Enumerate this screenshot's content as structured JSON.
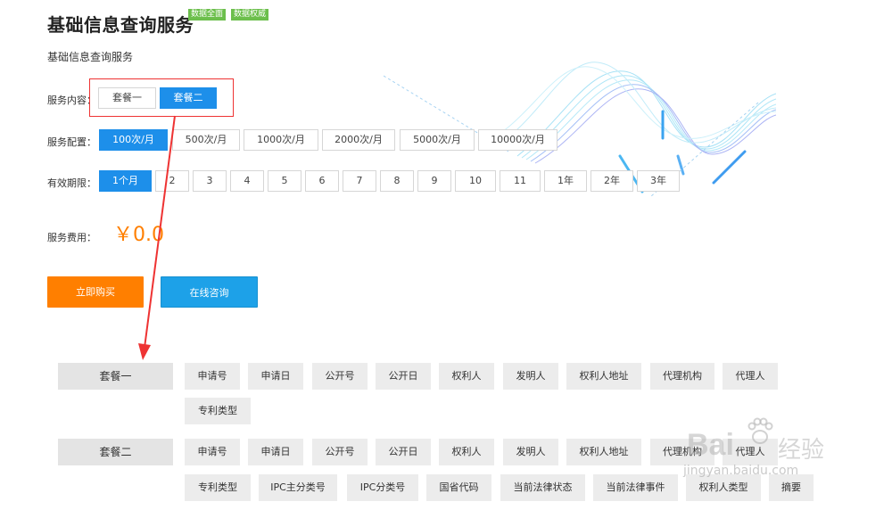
{
  "header": {
    "title": "基础信息查询服务",
    "badges": [
      "数据全面",
      "数据权威"
    ],
    "subtitle": "基础信息查询服务"
  },
  "service_content": {
    "label": "服务内容：",
    "options": [
      "套餐一",
      "套餐二"
    ],
    "selected": "套餐二"
  },
  "service_config": {
    "label": "服务配置：",
    "options": [
      "100次/月",
      "500次/月",
      "1000次/月",
      "2000次/月",
      "5000次/月",
      "10000次/月"
    ],
    "selected": "100次/月"
  },
  "validity": {
    "label": "有效期限：",
    "options": [
      "1个月",
      "2",
      "3",
      "4",
      "5",
      "6",
      "7",
      "8",
      "9",
      "10",
      "11",
      "1年",
      "2年",
      "3年"
    ],
    "selected": "1个月"
  },
  "fee": {
    "label": "服务费用：",
    "price": "￥0.0"
  },
  "actions": {
    "buy_label": "立即购买",
    "consult_label": "在线咨询"
  },
  "packages": [
    {
      "name": "套餐一",
      "fields": [
        "申请号",
        "申请日",
        "公开号",
        "公开日",
        "权利人",
        "发明人",
        "权利人地址",
        "代理机构",
        "代理人",
        "专利类型"
      ]
    },
    {
      "name": "套餐二",
      "fields": [
        "申请号",
        "申请日",
        "公开号",
        "公开日",
        "权利人",
        "发明人",
        "权利人地址",
        "代理机构",
        "代理人",
        "专利类型",
        "IPC主分类号",
        "IPC分类号",
        "国省代码",
        "当前法律状态",
        "当前法律事件",
        "权利人类型",
        "摘要"
      ]
    }
  ],
  "watermark": {
    "brand": "Bai",
    "brand_tail": "经验",
    "url": "jingyan.baidu.com"
  },
  "colors": {
    "accent_blue": "#1d8fea",
    "orange": "#ff7f00",
    "badge_green": "#6cbf4c",
    "highlight_red": "#e33333"
  }
}
